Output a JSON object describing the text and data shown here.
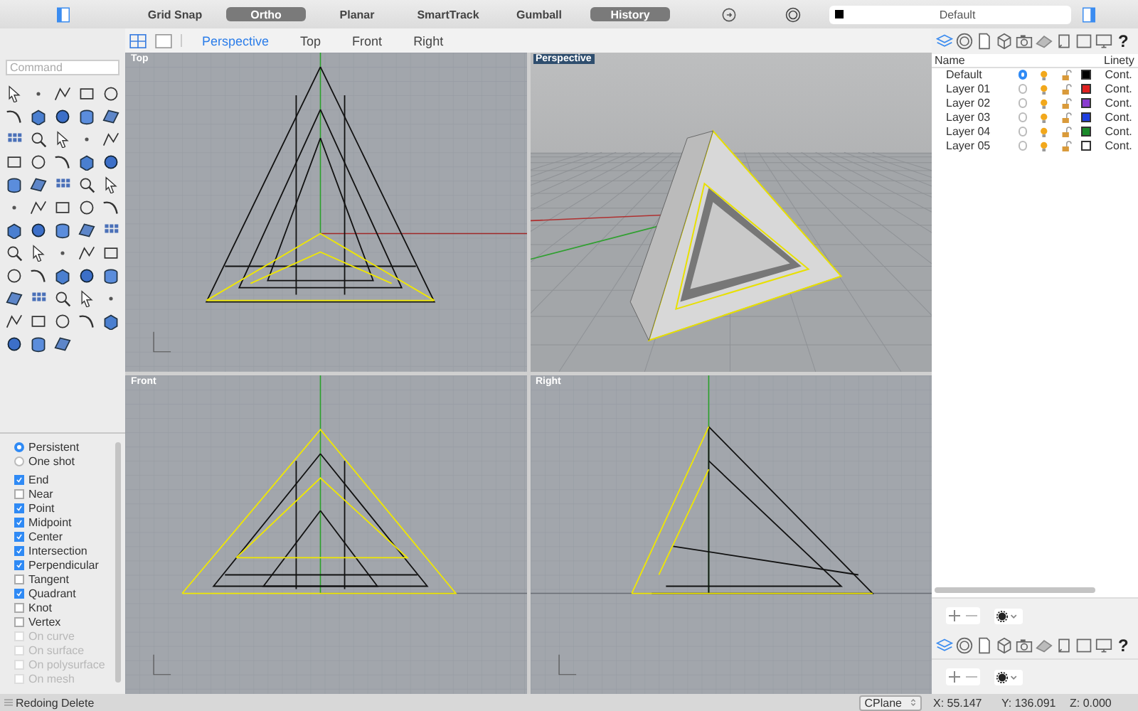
{
  "toolbar": {
    "toggles": [
      {
        "label": "Grid Snap",
        "on": false
      },
      {
        "label": "Ortho",
        "on": true
      },
      {
        "label": "Planar",
        "on": false
      },
      {
        "label": "SmartTrack",
        "on": false
      },
      {
        "label": "Gumball",
        "on": false
      },
      {
        "label": "History",
        "on": true
      }
    ],
    "layer_selector": {
      "value": "Default",
      "color": "#000000"
    }
  },
  "viewport_tabs": [
    {
      "label": "Perspective",
      "selected": true
    },
    {
      "label": "Top",
      "selected": false
    },
    {
      "label": "Front",
      "selected": false
    },
    {
      "label": "Right",
      "selected": false
    }
  ],
  "command": {
    "placeholder": "Command"
  },
  "osnap": {
    "modes": [
      {
        "label": "Persistent",
        "selected": true
      },
      {
        "label": "One shot",
        "selected": false
      }
    ],
    "snaps": [
      {
        "label": "End",
        "checked": true,
        "disabled": false
      },
      {
        "label": "Near",
        "checked": false,
        "disabled": false
      },
      {
        "label": "Point",
        "checked": true,
        "disabled": false
      },
      {
        "label": "Midpoint",
        "checked": true,
        "disabled": false
      },
      {
        "label": "Center",
        "checked": true,
        "disabled": false
      },
      {
        "label": "Intersection",
        "checked": true,
        "disabled": false
      },
      {
        "label": "Perpendicular",
        "checked": true,
        "disabled": false
      },
      {
        "label": "Tangent",
        "checked": false,
        "disabled": false
      },
      {
        "label": "Quadrant",
        "checked": true,
        "disabled": false
      },
      {
        "label": "Knot",
        "checked": false,
        "disabled": false
      },
      {
        "label": "Vertex",
        "checked": false,
        "disabled": false
      },
      {
        "label": "On curve",
        "checked": false,
        "disabled": true
      },
      {
        "label": "On surface",
        "checked": false,
        "disabled": true
      },
      {
        "label": "On polysurface",
        "checked": false,
        "disabled": true
      },
      {
        "label": "On mesh",
        "checked": false,
        "disabled": true
      }
    ]
  },
  "viewports": [
    {
      "title": "Top",
      "kind": "top",
      "active": false
    },
    {
      "title": "Perspective",
      "kind": "perspective",
      "active": true
    },
    {
      "title": "Front",
      "kind": "front",
      "active": false
    },
    {
      "title": "Right",
      "kind": "right",
      "active": false
    }
  ],
  "layers": {
    "columns": [
      "Name",
      "Linety"
    ],
    "rows": [
      {
        "name": "Default",
        "current": true,
        "color": "#000000",
        "linetype": "Cont."
      },
      {
        "name": "Layer 01",
        "current": false,
        "color": "#e02020",
        "linetype": "Cont."
      },
      {
        "name": "Layer 02",
        "current": false,
        "color": "#8a3ccf",
        "linetype": "Cont."
      },
      {
        "name": "Layer 03",
        "current": false,
        "color": "#1f3fe0",
        "linetype": "Cont."
      },
      {
        "name": "Layer 04",
        "current": false,
        "color": "#1a8a2a",
        "linetype": "Cont."
      },
      {
        "name": "Layer 05",
        "current": false,
        "color": "#ffffff",
        "linetype": "Cont."
      }
    ]
  },
  "panel_tab_bars": [
    {
      "help": "?"
    },
    {
      "help": "?"
    }
  ],
  "status_bar": {
    "message": "Redoing Delete",
    "cplane": "CPlane",
    "x": "X: 55.147",
    "y": "Y: 136.091",
    "z": "Z: 0.000"
  }
}
